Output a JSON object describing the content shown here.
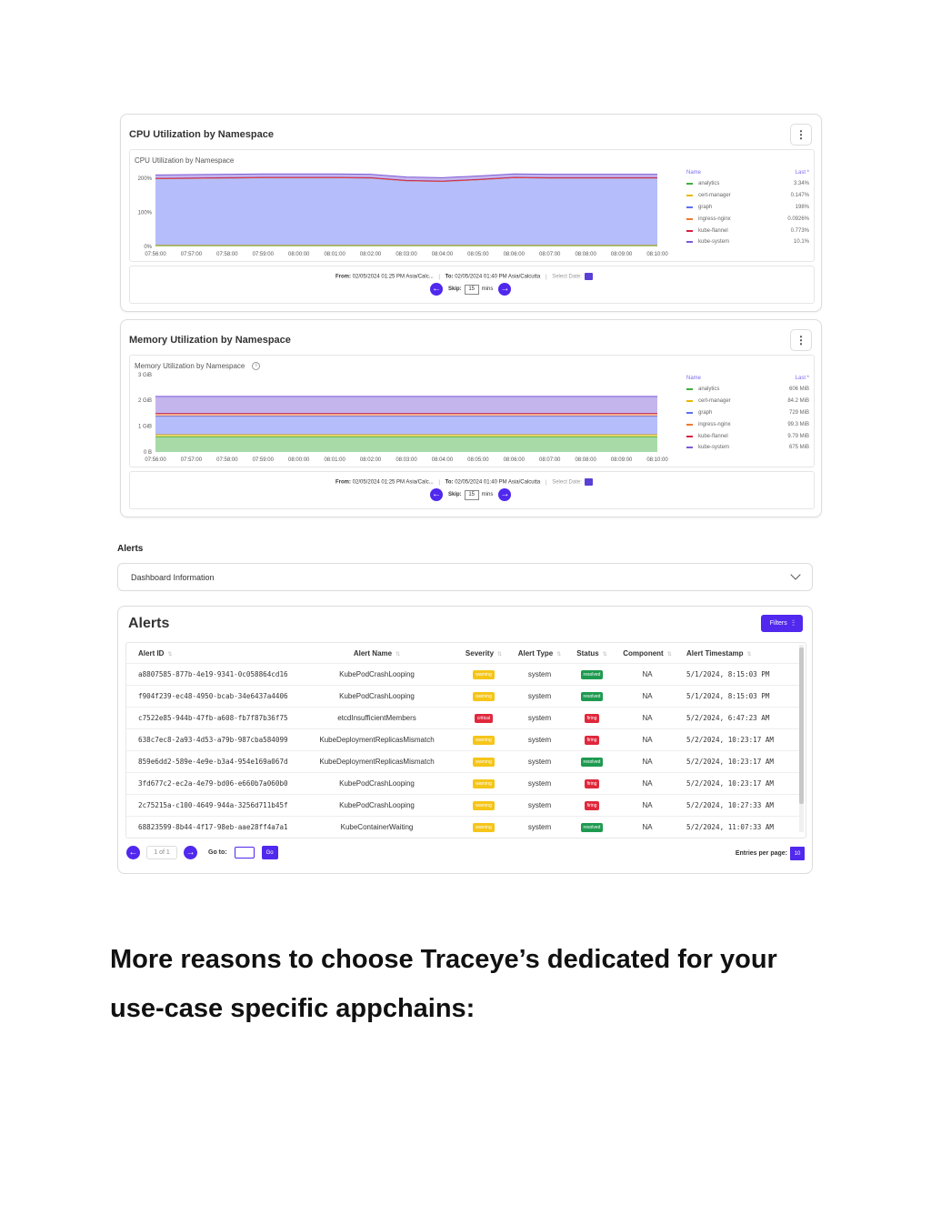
{
  "cpu_panel": {
    "title": "CPU Utilization by Namespace",
    "chart_title": "CPU Utilization by Namespace",
    "kebab": "⋮",
    "legend_name_header": "Name",
    "legend_last_header": "Last *",
    "from_label": "From:",
    "from_value": "02/05/2024 01:25 PM Asia/Calc...",
    "to_label": "To:",
    "to_value": "02/05/2024 01:40 PM Asia/Calcutta",
    "select_date": "Select Date:",
    "skip_label": "Skip:",
    "skip_value": "15",
    "skip_unit": "mins"
  },
  "memory_panel": {
    "title": "Memory Utilization by Namespace",
    "chart_title": "Memory Utilization by Namespace",
    "kebab": "⋮",
    "legend_name_header": "Name",
    "legend_last_header": "Last *",
    "from_label": "From:",
    "from_value": "02/05/2024 01:25 PM Asia/Calc...",
    "to_label": "To:",
    "to_value": "02/05/2024 01:40 PM Asia/Calcutta",
    "select_date": "Select Date:",
    "skip_label": "Skip:",
    "skip_value": "15",
    "skip_unit": "mins"
  },
  "chart_data": [
    {
      "type": "area",
      "title": "CPU Utilization by Namespace",
      "x": [
        "07:56:00",
        "07:57:00",
        "07:58:00",
        "07:59:00",
        "08:00:00",
        "08:01:00",
        "08:02:00",
        "08:03:00",
        "08:04:00",
        "08:05:00",
        "08:06:00",
        "08:07:00",
        "08:08:00",
        "08:09:00",
        "08:10:00"
      ],
      "y_ticks": [
        "0%",
        "100%",
        "200%"
      ],
      "ylim": [
        0,
        230
      ],
      "stacked": true,
      "legend_placement": "right",
      "series": [
        {
          "name": "analytics",
          "last": "3.34%",
          "color": "#3fae3f",
          "values": [
            3,
            3,
            3,
            3,
            3,
            3,
            3,
            3,
            3,
            3,
            3,
            3,
            3,
            3,
            3
          ]
        },
        {
          "name": "cert-manager",
          "last": "0.147%",
          "color": "#e8b800",
          "values": [
            0.2,
            0.2,
            0.2,
            0.2,
            0.2,
            0.2,
            0.2,
            0.2,
            0.2,
            0.2,
            0.2,
            0.2,
            0.2,
            0.2,
            0.2
          ]
        },
        {
          "name": "graph",
          "last": "198%",
          "color": "#5c6ef5",
          "values": [
            196,
            197,
            198,
            199,
            199,
            199,
            198,
            190,
            188,
            193,
            199,
            198,
            198,
            198,
            198
          ]
        },
        {
          "name": "ingress-nginx",
          "last": "0.0926%",
          "color": "#f07830",
          "values": [
            0.1,
            0.1,
            0.1,
            0.1,
            0.1,
            0.1,
            0.1,
            0.1,
            0.1,
            0.1,
            0.1,
            0.1,
            0.1,
            0.1,
            0.1
          ]
        },
        {
          "name": "kube-flannel",
          "last": "0.773%",
          "color": "#d82040",
          "values": [
            1,
            1,
            1,
            1,
            1,
            1,
            1,
            1,
            1,
            1,
            1,
            1,
            1,
            1,
            1
          ]
        },
        {
          "name": "kube-system",
          "last": "10.1%",
          "color": "#7d5ad8",
          "values": [
            10,
            10,
            10,
            10,
            10,
            10,
            10,
            10,
            10,
            10,
            10,
            10,
            10,
            10,
            10
          ]
        }
      ]
    },
    {
      "type": "area",
      "title": "Memory Utilization by Namespace",
      "x": [
        "07:56:00",
        "07:57:00",
        "07:58:00",
        "07:59:00",
        "08:00:00",
        "08:01:00",
        "08:02:00",
        "08:03:00",
        "08:04:00",
        "08:05:00",
        "08:06:00",
        "08:07:00",
        "08:08:00",
        "08:09:00",
        "08:10:00"
      ],
      "y_ticks": [
        "0 B",
        "1 GiB",
        "2 GiB",
        "3 GiB"
      ],
      "ylim": [
        0,
        3100
      ],
      "stacked": true,
      "legend_placement": "right",
      "series": [
        {
          "name": "analytics",
          "last": "606 MiB",
          "color": "#3fae3f",
          "values": [
            606,
            606,
            606,
            606,
            606,
            606,
            606,
            606,
            606,
            606,
            606,
            606,
            606,
            606,
            606
          ]
        },
        {
          "name": "cert-manager",
          "last": "84.2 MiB",
          "color": "#e8b800",
          "values": [
            84,
            84,
            84,
            84,
            84,
            84,
            84,
            84,
            84,
            84,
            84,
            84,
            84,
            84,
            84
          ]
        },
        {
          "name": "graph",
          "last": "729 MiB",
          "color": "#5c6ef5",
          "values": [
            729,
            729,
            729,
            729,
            729,
            729,
            729,
            729,
            729,
            729,
            729,
            729,
            729,
            729,
            729
          ]
        },
        {
          "name": "ingress-nginx",
          "last": "99.3 MiB",
          "color": "#f07830",
          "values": [
            99,
            99,
            99,
            99,
            99,
            99,
            99,
            99,
            99,
            99,
            99,
            99,
            99,
            99,
            99
          ]
        },
        {
          "name": "kube-flannel",
          "last": "9.79 MiB",
          "color": "#d82040",
          "values": [
            10,
            10,
            10,
            10,
            10,
            10,
            10,
            10,
            10,
            10,
            10,
            10,
            10,
            10,
            10
          ]
        },
        {
          "name": "kube-system",
          "last": "675 MiB",
          "color": "#7d5ad8",
          "values": [
            675,
            675,
            675,
            675,
            675,
            675,
            675,
            675,
            675,
            675,
            675,
            675,
            675,
            675,
            675
          ]
        }
      ]
    }
  ],
  "alerts_section_label": "Alerts",
  "dashboard_info": {
    "label": "Dashboard Information"
  },
  "alerts": {
    "title": "Alerts",
    "filters_label": "Filters",
    "columns": [
      "Alert ID",
      "Alert Name",
      "Severity",
      "Alert Type",
      "Status",
      "Component",
      "Alert Timestamp"
    ],
    "severity_colors": {
      "warning": "#f5c518",
      "critical": "#e0283c"
    },
    "status_colors": {
      "resolved": "#1e9a50",
      "firing": "#e0283c"
    },
    "rows": [
      {
        "id": "a8807585-877b-4e19-9341-0c058864cd16",
        "name": "KubePodCrashLooping",
        "severity": "warning",
        "type": "system",
        "status": "resolved",
        "component": "NA",
        "timestamp": "5/1/2024, 8:15:03 PM"
      },
      {
        "id": "f904f239-ec48-4950-bcab-34e6437a4406",
        "name": "KubePodCrashLooping",
        "severity": "warning",
        "type": "system",
        "status": "resolved",
        "component": "NA",
        "timestamp": "5/1/2024, 8:15:03 PM"
      },
      {
        "id": "c7522e85-944b-47fb-a608-fb7f87b36f75",
        "name": "etcdInsufficientMembers",
        "severity": "critical",
        "type": "system",
        "status": "firing",
        "component": "NA",
        "timestamp": "5/2/2024, 6:47:23 AM"
      },
      {
        "id": "638c7ec8-2a93-4d53-a79b-987cba584099",
        "name": "KubeDeploymentReplicasMismatch",
        "severity": "warning",
        "type": "system",
        "status": "firing",
        "component": "NA",
        "timestamp": "5/2/2024, 10:23:17 AM"
      },
      {
        "id": "859e6dd2-589e-4e9e-b3a4-954e169a067d",
        "name": "KubeDeploymentReplicasMismatch",
        "severity": "warning",
        "type": "system",
        "status": "resolved",
        "component": "NA",
        "timestamp": "5/2/2024, 10:23:17 AM"
      },
      {
        "id": "3fd677c2-ec2a-4e79-bd06-e660b7a060b0",
        "name": "KubePodCrashLooping",
        "severity": "warning",
        "type": "system",
        "status": "firing",
        "component": "NA",
        "timestamp": "5/2/2024, 10:23:17 AM"
      },
      {
        "id": "2c75215a-c100-4649-944a-3256d711b45f",
        "name": "KubePodCrashLooping",
        "severity": "warning",
        "type": "system",
        "status": "firing",
        "component": "NA",
        "timestamp": "5/2/2024, 10:27:33 AM"
      },
      {
        "id": "68823599-8b44-4f17-98eb-aae28ff4a7a1",
        "name": "KubeContainerWaiting",
        "severity": "warning",
        "type": "system",
        "status": "resolved",
        "component": "NA",
        "timestamp": "5/2/2024, 11:07:33 AM"
      }
    ],
    "pagination": {
      "prev_icon": "←",
      "next_icon": "→",
      "page_indicator": "1 of 1",
      "goto_label": "Go to:",
      "go_button": "Go",
      "entries_label": "Entries per page:",
      "entries_value": "10"
    }
  },
  "heading": "More reasons to choose Traceye’s dedicated for your use-case specific appchains:"
}
